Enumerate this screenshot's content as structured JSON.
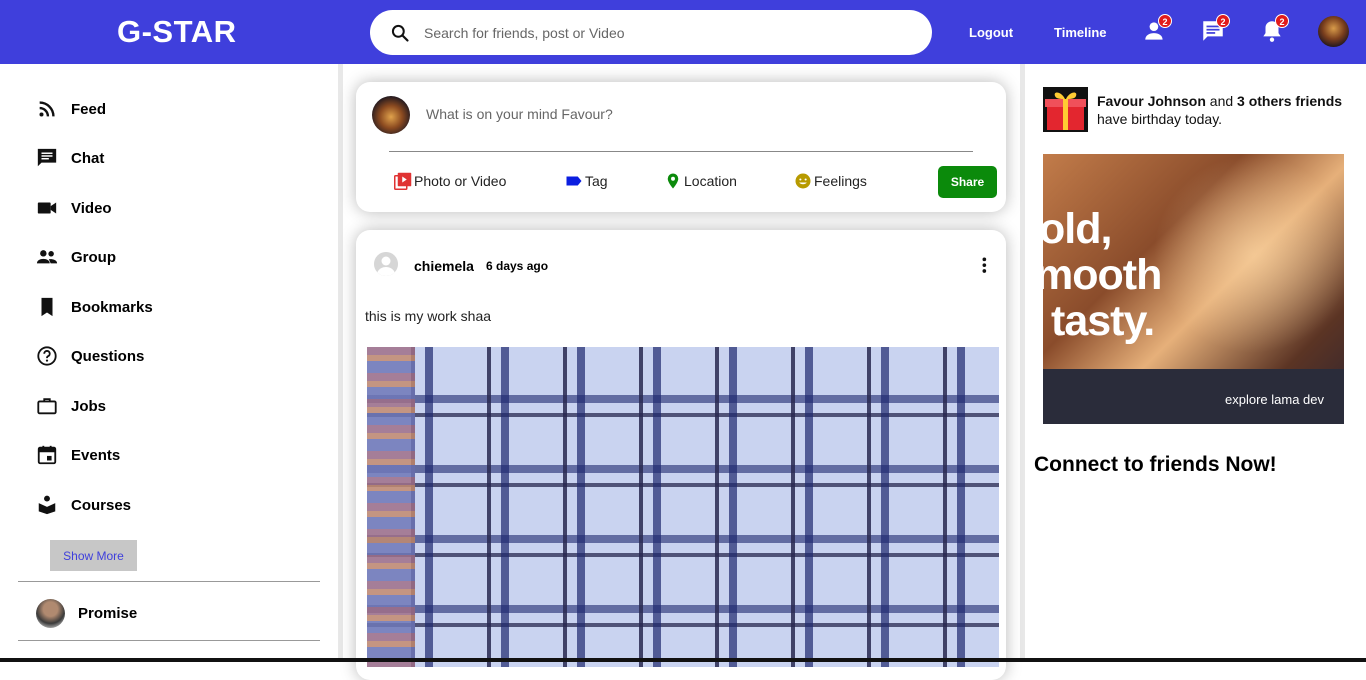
{
  "header": {
    "logo": "G-STAR",
    "search_placeholder": "Search for friends, post or Video",
    "logout": "Logout",
    "timeline": "Timeline",
    "friend_requests_count": "2",
    "messages_count": "2",
    "notifications_count": "2",
    "brand_color": "#3f3fdc"
  },
  "sidebar": {
    "items": [
      {
        "label": "Feed",
        "icon": "rss-icon"
      },
      {
        "label": "Chat",
        "icon": "chat-icon"
      },
      {
        "label": "Video",
        "icon": "video-icon"
      },
      {
        "label": "Group",
        "icon": "group-icon"
      },
      {
        "label": "Bookmarks",
        "icon": "bookmark-icon"
      },
      {
        "label": "Questions",
        "icon": "help-circle-icon"
      },
      {
        "label": "Jobs",
        "icon": "briefcase-icon"
      },
      {
        "label": "Events",
        "icon": "calendar-icon"
      },
      {
        "label": "Courses",
        "icon": "school-icon"
      }
    ],
    "show_more": "Show More",
    "friends": [
      {
        "name": "Promise"
      }
    ]
  },
  "share": {
    "placeholder": "What is on your mind Favour?",
    "options": {
      "photo": "Photo or Video",
      "tag": "Tag",
      "location": "Location",
      "feelings": "Feelings"
    },
    "share_button": "Share"
  },
  "post": {
    "username": "chiemela",
    "time": "6 days ago",
    "text": "this is my work shaa"
  },
  "rightbar": {
    "birthday_name": "Favour Johnson",
    "birthday_and": "and",
    "birthday_others": "3 others friends",
    "birthday_suffix": "have birthday today.",
    "ad_tagline_1": "old,",
    "ad_tagline_2": "mooth",
    "ad_tagline_3": "tasty.",
    "ad_small": "explore lama dev",
    "connect_title": "Connect to friends Now!"
  }
}
